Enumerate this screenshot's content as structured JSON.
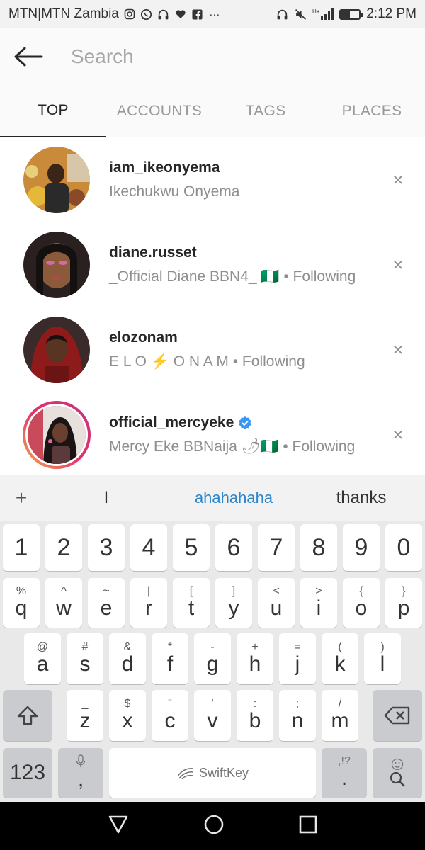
{
  "status_bar": {
    "carrier": "MTN|MTN Zambia",
    "time": "2:12 PM",
    "battery_level": 0.45,
    "notification_icons": [
      "instagram-icon",
      "whatsapp-icon",
      "headphones-icon",
      "heart-icon",
      "facebook-icon",
      "more-dots-icon"
    ],
    "right_icons": [
      "headphones-icon",
      "mute-icon",
      "signal-icon",
      "battery-icon"
    ],
    "more_glyph": "···",
    "signal_label": "H+"
  },
  "search": {
    "placeholder": "Search"
  },
  "tabs": [
    {
      "label": "TOP",
      "active": true
    },
    {
      "label": "ACCOUNTS",
      "active": false
    },
    {
      "label": "TAGS",
      "active": false
    },
    {
      "label": "PLACES",
      "active": false
    }
  ],
  "results": [
    {
      "username": "iam_ikeonyema",
      "subtitle": "Ikechukwu Onyema",
      "verified": false,
      "story_ring": false
    },
    {
      "username": "diane.russet",
      "subtitle": "_Official Diane BBN4_ 🇳🇬 • Following",
      "verified": false,
      "story_ring": false
    },
    {
      "username": "elozonam",
      "subtitle": "E L O ⚡ O N A M • Following",
      "verified": false,
      "story_ring": false
    },
    {
      "username": "official_mercyeke",
      "subtitle": "Mercy Eke BBNaija 🌶🇳🇬 • Following",
      "verified": true,
      "story_ring": true
    }
  ],
  "remove_glyph": "×",
  "suggestions": {
    "plus": "+",
    "items": [
      "I",
      "ahahahaha",
      "thanks"
    ]
  },
  "keyboard": {
    "number_row": [
      "1",
      "2",
      "3",
      "4",
      "5",
      "6",
      "7",
      "8",
      "9",
      "0"
    ],
    "row1": [
      {
        "main": "q",
        "sub": "%"
      },
      {
        "main": "w",
        "sub": "^"
      },
      {
        "main": "e",
        "sub": "~"
      },
      {
        "main": "r",
        "sub": "|"
      },
      {
        "main": "t",
        "sub": "["
      },
      {
        "main": "y",
        "sub": "]"
      },
      {
        "main": "u",
        "sub": "<"
      },
      {
        "main": "i",
        "sub": ">"
      },
      {
        "main": "o",
        "sub": "{"
      },
      {
        "main": "p",
        "sub": "}"
      }
    ],
    "row2": [
      {
        "main": "a",
        "sub": "@"
      },
      {
        "main": "s",
        "sub": "#"
      },
      {
        "main": "d",
        "sub": "&"
      },
      {
        "main": "f",
        "sub": "*"
      },
      {
        "main": "g",
        "sub": "-"
      },
      {
        "main": "h",
        "sub": "+"
      },
      {
        "main": "j",
        "sub": "="
      },
      {
        "main": "k",
        "sub": "("
      },
      {
        "main": "l",
        "sub": ")"
      }
    ],
    "row3": [
      {
        "main": "z",
        "sub": "_"
      },
      {
        "main": "x",
        "sub": "$"
      },
      {
        "main": "c",
        "sub": "\""
      },
      {
        "main": "v",
        "sub": "'"
      },
      {
        "main": "b",
        "sub": ":"
      },
      {
        "main": "n",
        "sub": ";"
      },
      {
        "main": "m",
        "sub": "/"
      }
    ],
    "shift_icon": "shift-icon",
    "backspace_icon": "backspace-icon",
    "numbers_label": "123",
    "comma_label": ",",
    "space_label": "SwiftKey",
    "period_label": ".",
    "period_sub": ",!?",
    "search_icon": "search-icon"
  },
  "nav_bar": {
    "icons": [
      "back-triangle-icon",
      "home-circle-icon",
      "recents-square-icon"
    ]
  },
  "colors": {
    "link_blue": "#2e86c9",
    "verified_blue": "#3897f0",
    "secondary_text": "#8e8e8e"
  }
}
